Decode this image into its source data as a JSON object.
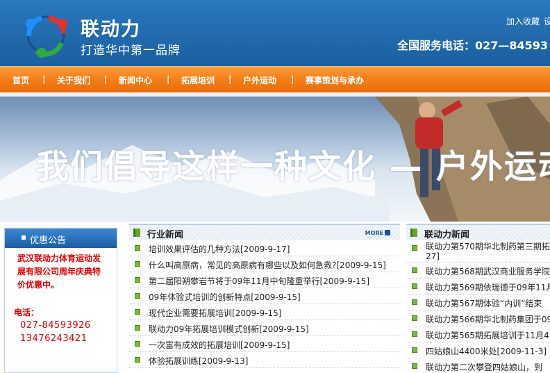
{
  "header": {
    "brand": "联动力",
    "slogan": "打造华中第一品牌",
    "top_links": [
      "加入收藏",
      "设"
    ],
    "phone": "全国服务电话：027—84593"
  },
  "nav": {
    "items": [
      "首页",
      "关于我们",
      "新闻中心",
      "拓展培训",
      "户外运动",
      "赛事策划与承办"
    ],
    "separator": "|"
  },
  "banner": {
    "text": "我们倡导这样一种文化 — 户外运动"
  },
  "sidebar": {
    "title": "优惠公告",
    "promo": "武汉联动力体育运动发展有限公司周年庆典特价优惠中。",
    "contact_label": "电话：",
    "phones": [
      "027-84593926",
      "13476243421"
    ]
  },
  "industry_news": {
    "title": "行业新闻",
    "more": "MORE",
    "items": [
      "培训效果评估的几种方法[2009-9-17]",
      "什么叫高原病，常见的高原病有哪些以及如何急救?[2009-9-15]",
      "第二届阳朔攀岩节将于09年11月中旬隆重举行[2009-9-15]",
      "09年体验式培训的创新特点[2009-9-15]",
      "现代企业需要拓展培训[2009-9-15]",
      "联动力09年拓展培训模式创新[2009-9-15]",
      "一次富有成效的拓展培训[2009-9-15]",
      "体验拓展训练[2009-9-13]"
    ]
  },
  "company_news": {
    "title": "联动力新闻",
    "items": [
      "联动力第570期华北制药第三期拓27]",
      "联动力第568期武汉商业服务学院",
      "联动力第569期依瑞德于09年11月",
      "联动力第567期体验“内训”结束",
      "联动力第566期华北制药集团于09",
      "联动力第565期拓展培训于11月4",
      "四姑娘山4400米处[2009-11-3]",
      "联动力第二次攀登四姑娘山，到"
    ]
  },
  "colors": {
    "header_blue": "#1d64a6",
    "nav_orange": "#f47b16",
    "promo_red": "#e00000",
    "accent_green": "#6aa329"
  }
}
